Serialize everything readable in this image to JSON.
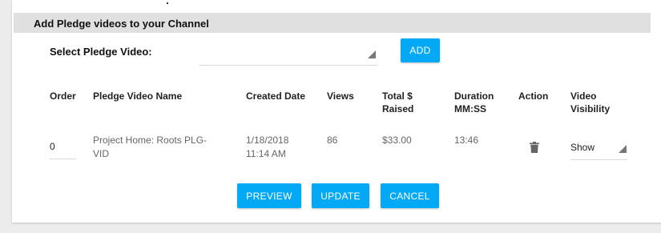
{
  "section": {
    "title": "Add Pledge videos to your Channel"
  },
  "picker": {
    "label": "Select Pledge Video:",
    "selected": "",
    "add_label": "ADD"
  },
  "table": {
    "headers": {
      "order": "Order",
      "name": "Pledge Video Name",
      "created": "Created Date",
      "views": "Views",
      "raised_line1": "Total $",
      "raised_line2": "Raised",
      "duration_line1": "Duration",
      "duration_line2": "MM:SS",
      "action": "Action",
      "visibility_line1": "Video",
      "visibility_line2": "Visibility"
    },
    "rows": [
      {
        "order": "0",
        "name_line1": "Project Home: Roots PLG-",
        "name_line2": "VID",
        "created_line1": "1/18/2018",
        "created_line2": "11:14 AM",
        "views": "86",
        "raised": "$33.00",
        "duration": "13:46",
        "action_icon": "trash-icon",
        "visibility": "Show"
      }
    ]
  },
  "actions": {
    "preview_label": "PREVIEW",
    "update_label": "UPDATE",
    "cancel_label": "CANCEL"
  },
  "colors": {
    "primary_button": "#03a9f4",
    "header_background": "#e0e0e0",
    "page_background": "#ececec"
  }
}
